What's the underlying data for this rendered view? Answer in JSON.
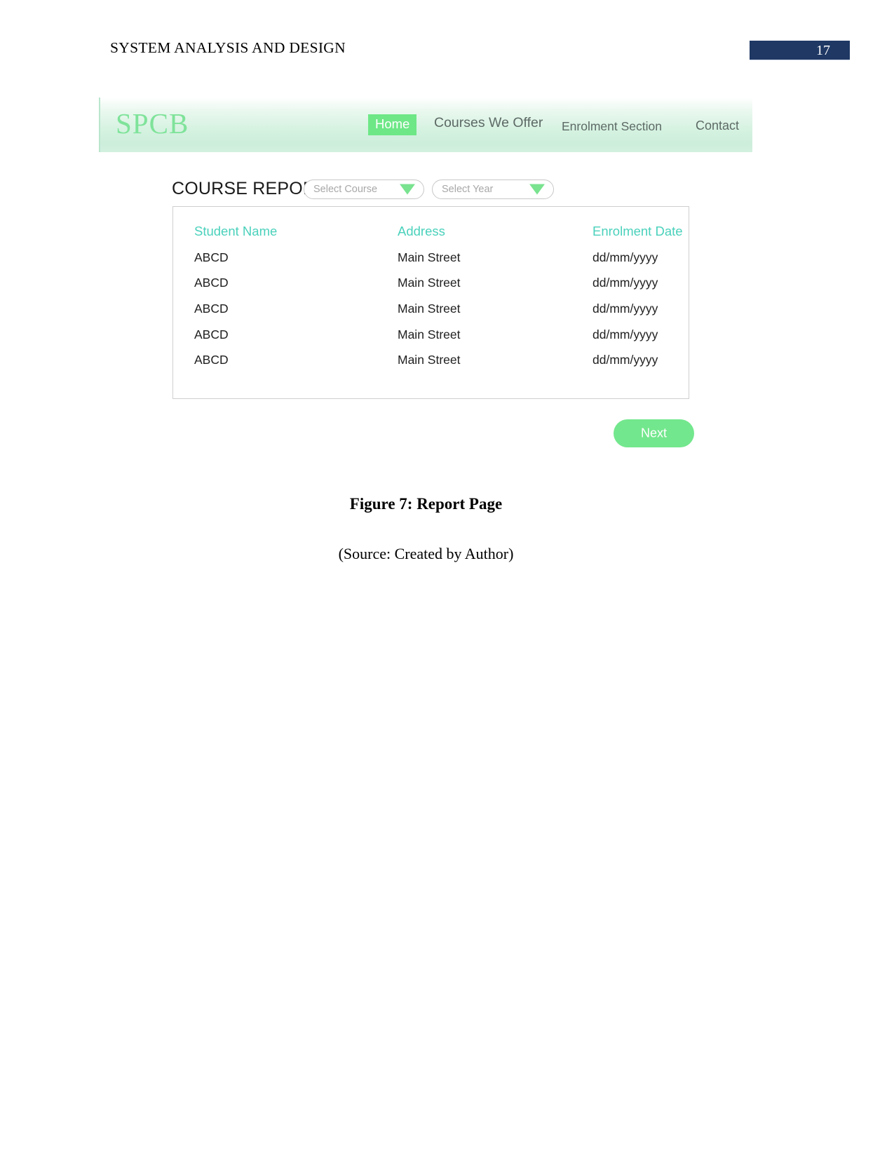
{
  "document": {
    "running_head": "SYSTEM ANALYSIS AND DESIGN",
    "page_number": "17",
    "page_number_bg": "#1f3864",
    "figure_caption": "Figure 7: Report Page",
    "source_caption": "(Source: Created by Author)"
  },
  "screenshot": {
    "navbar": {
      "logo": "SPCB",
      "logo_color": "#7fe39a",
      "active_bg": "#6ee787",
      "items": [
        {
          "label": "Home",
          "active": true
        },
        {
          "label": "Courses We Offer",
          "active": false
        },
        {
          "label": "Enrolment Section",
          "active": false
        },
        {
          "label": "Contact",
          "active": false
        }
      ]
    },
    "report": {
      "title": "COURSE REPORT",
      "filters": [
        {
          "name": "course",
          "placeholder": "Select Course",
          "value": "",
          "caret": "chevron-down-icon"
        },
        {
          "name": "year",
          "placeholder": "Select Year",
          "value": "",
          "caret": "chevron-down-icon"
        }
      ],
      "table": {
        "header_color": "#4ad1bb",
        "columns": [
          "Student Name",
          "Address",
          "Enrolment Date"
        ],
        "rows": [
          [
            "ABCD",
            "Main Street",
            "dd/mm/yyyy"
          ],
          [
            "ABCD",
            "Main Street",
            "dd/mm/yyyy"
          ],
          [
            "ABCD",
            "Main Street",
            "dd/mm/yyyy"
          ],
          [
            "ABCD",
            "Main Street",
            "dd/mm/yyyy"
          ],
          [
            "ABCD",
            "Main Street",
            "dd/mm/yyyy"
          ]
        ]
      },
      "next_button": {
        "label": "Next",
        "color": "#73e78d"
      }
    }
  }
}
